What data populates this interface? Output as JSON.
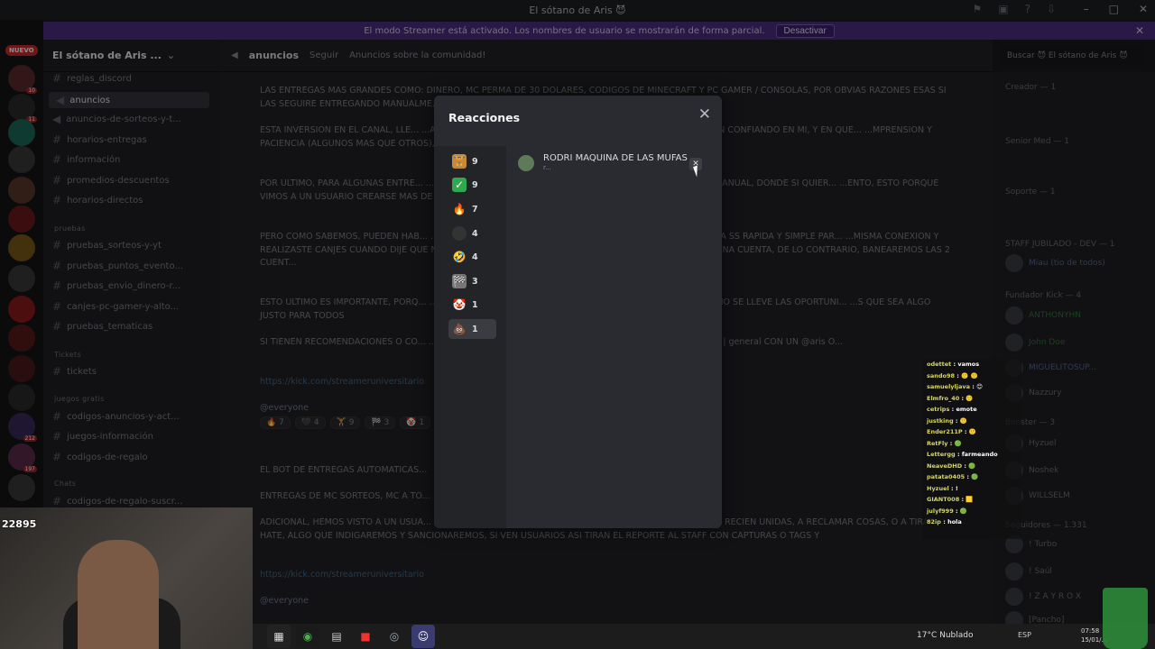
{
  "window": {
    "title": "El sótano de Aris 😈"
  },
  "streamer_bar": {
    "text": "El modo Streamer está activado. Los nombres de usuario se mostrarán de forma parcial.",
    "button": "Desactivar"
  },
  "guilds": {
    "new_badge": "NUEVO"
  },
  "server": {
    "name": "El sótano de Aris ..."
  },
  "channels": [
    {
      "label": "reglas_discord"
    },
    {
      "label": "anuncios"
    },
    {
      "label": "anuncios-de-sorteos-y-t..."
    },
    {
      "label": "horarios-entregas"
    },
    {
      "label": "información"
    },
    {
      "label": "promedios-descuentos"
    },
    {
      "label": "horarios-directos"
    },
    {
      "label": "pruebas_sorteos-y-yt"
    },
    {
      "label": "pruebas_puntos_evento..."
    },
    {
      "label": "pruebas_envio_dinero-r..."
    },
    {
      "label": "canjes-pc-gamer-y-alto..."
    },
    {
      "label": "pruebas_tematicas"
    },
    {
      "label": "tickets"
    },
    {
      "label": "codigos-anuncios-y-act..."
    },
    {
      "label": "juegos-información"
    },
    {
      "label": "codigos-de-regalo"
    },
    {
      "label": "codigos-de-regalo-suscr..."
    }
  ],
  "categories": {
    "pruebas": "pruebas",
    "tickets": "Tickets",
    "juegos": "juegos gratis",
    "chats": "Chats"
  },
  "channel_header": {
    "name": "anuncios",
    "follow": "Seguir",
    "topic": "Anuncios sobre la comunidad!",
    "search": "Buscar 😈 El sótano de Aris 😈"
  },
  "messages": [
    "LAS ENTREGAS MAS GRANDES COMO: DINERO, MC PERMA DE 30 DOLARES, CODIGOS DE MINECRAFT Y PC GAMER / CONSOLAS, POR OBVIAS RAZONES ESAS SI LAS SEGUIRE ENTREGANDO MANUALME...                                                          ...PROCESO LO MAXIMO POSIBLE)",
    "ESTA INVERSION EN EL CANAL, LLE...                              ...ADEZCO A TODOS LOS QUE DURANTE EL AÑO QUE PASO SIGUIERON CONFIANDO EN MI, Y EN QUE...                    ...MPRENSION Y PACIENCIA (ALGUNOS MAS QUE OTROS), ESTE ES HASTA EL MOMENTO UNO DE LO...                                   ...VEAN",
    "POR ULTIMO, PARA ALGUNAS ENTRE...                                ...PERMANENTE CUENTA Y DINERO, REALIZARE UNA VERIFICACION MANUAL, DONDE SI QUIER...                    ...ENTO, ESTO PORQUE VIMOS A UN USUARIO CREARSE MAS DE 8 CUENTAS YA CONFIRMADAS PARA...                                ...ADAS ⚠️",
    "PERO COMO SABEMOS, PUEDEN HAB...                           ...ESTAS MISMAS PRACTICAS, POR LO CUAL, VAMOS A REALIZAR UNA SS RAPIDA Y SIMPLE PAR...                   ...MISMA CONEXION Y REALIZASTE CANJES CUANDO DIJE QUE NO HICIERAN MAS ESTO, TE DOY LA...                  ...BOLSO Y SOLO SE BANEA UNA CUENTA, DE LO CONTRARIO, BANEAREMOS LAS 2 CUENT...",
    "ESTO ULTIMO ES IMPORTANTE, PORQ...                          ...PERA ENTRE CANJE Y CANJE, Y NO ES JUSTO QUE UN SOLO USUARIO SE LLEVE LAS OPORTUNI...                       ...S QUE SEA ALGO JUSTO PARA TODOS",
    "SI TIENEN RECOMENDACIONES O CO...                        ...TICAS PUEDEN HACERNOSLO SABER, ESCRIBIENDO EN EL CHAT # | general  CON UN @aris  O..."
  ],
  "link1": "https://kick.com/streameruniversitario",
  "everyone": "@everyone",
  "bot_msg": "EL BOT DE ENTREGAS AUTOMATICAS...",
  "msg2": "ENTREGAS DE MC SORTEOS, MC A TO...",
  "msg3": "ADICIONAL, HEMOS VISTO A UN USUA...                                                        ...SE ANDA UNIENDO CON CUENTAS QUE SOSPECHOSAMENTE SON RECIEN UNIDAS, A RECLAMAR COSAS, O A TIRAR HATE, ALGO QUE INDIGAREMOS Y SANCIONAREMOS, SI VEN USUARIOS ASI TIRAN EL REPORTE AL STAFF CON CAPTURAS O TAGS Y",
  "reaction_bar": [
    "7",
    "4",
    "9",
    "3",
    "1"
  ],
  "members": {
    "creador": "Creador — 1",
    "senior": "Senior Med — 1",
    "soporte": "Soporte — 1",
    "staff": "STAFF JUBILADO - DEV — 1",
    "fundador": "Fundador Kick — 4",
    "booster": "Booster — 3",
    "seguidores": "Seguidores — 1.331",
    "names": [
      "Miau (tio de todos)",
      "ANTHONYHN",
      "John Doe",
      "MIGUELITOSUP...",
      "Nazzury",
      "Hyzuel",
      "Noshek",
      "WILLSELM",
      "! Turbo",
      "! Saúl",
      "! Z A Y R O X",
      "[Pancho]"
    ]
  },
  "stream_chat": [
    {
      "u": "odettet",
      "m": "vamos"
    },
    {
      "u": "sando98",
      "m": "🙂 🙂"
    },
    {
      "u": "samuelyljava",
      "m": "😊"
    },
    {
      "u": "Elmfro_40",
      "m": "🙂"
    },
    {
      "u": "cetrips",
      "m": "emote"
    },
    {
      "u": "justking",
      "m": "🙂"
    },
    {
      "u": "Ender211P",
      "m": "🙂"
    },
    {
      "u": "RetFly",
      "m": "🟢"
    },
    {
      "u": "Lettergg",
      "m": "farmeando"
    },
    {
      "u": "NeaveDHD",
      "m": "🟢"
    },
    {
      "u": "patata0405",
      "m": "🟢"
    },
    {
      "u": "Hyzuel",
      "m": "!"
    },
    {
      "u": "GIANT008",
      "m": "🟨"
    },
    {
      "u": "julyf999",
      "m": "🟢"
    },
    {
      "u": "82ip",
      "m": "hola"
    }
  ],
  "modal": {
    "title": "Reacciones",
    "reactions": [
      {
        "emoji": "🏋",
        "count": "9",
        "color": "#c58b3a"
      },
      {
        "emoji": "✅",
        "count": "9",
        "color": "#2fa84f"
      },
      {
        "emoji": "🔥",
        "count": "7",
        "color": "#c8552a"
      },
      {
        "emoji": "🖤",
        "count": "4",
        "color": "#444"
      },
      {
        "emoji": "🤣",
        "count": "4",
        "color": "#e6b32a"
      },
      {
        "emoji": "🏁",
        "count": "3",
        "color": "#777"
      },
      {
        "emoji": "🤡",
        "count": "1",
        "color": "#e9d9c9"
      },
      {
        "emoji": "💩",
        "count": "1",
        "color": "#8a5530"
      }
    ],
    "user": {
      "name": "RODRI MAQUINA DE LAS MUFAS",
      "sub": "r..."
    }
  },
  "webcam": {
    "viewer_count": "22895"
  },
  "taskbar": {
    "weather": "17°C  Nublado",
    "lang": "ESP",
    "time": "07:58",
    "date": "15/01/..."
  }
}
